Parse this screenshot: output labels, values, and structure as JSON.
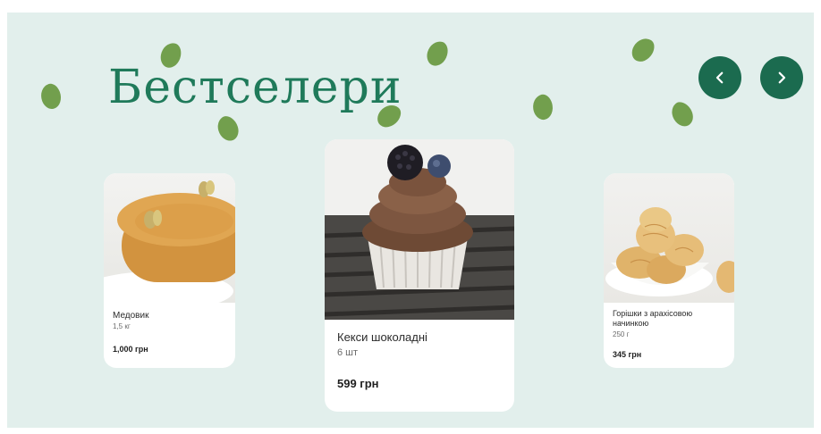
{
  "section": {
    "title": "Бестселери"
  },
  "carousel": {
    "prev_label": "previous",
    "next_label": "next"
  },
  "products": [
    {
      "name": "Медовик",
      "weight": "1,5 кг",
      "price": "1,000 грн"
    },
    {
      "name": "Кекси шоколадні",
      "weight": "6 шт",
      "price": "599 грн"
    },
    {
      "name": "Горішки з арахісовою начинкою",
      "weight": "250 г",
      "price": "345 грн"
    }
  ],
  "colors": {
    "background": "#e2efec",
    "accent": "#1b6b4f",
    "title": "#1f7a5a",
    "leaf": "#6c9a44"
  },
  "icons": [
    "chevron-left-icon",
    "chevron-right-icon",
    "pistachio-leaf-icon"
  ]
}
